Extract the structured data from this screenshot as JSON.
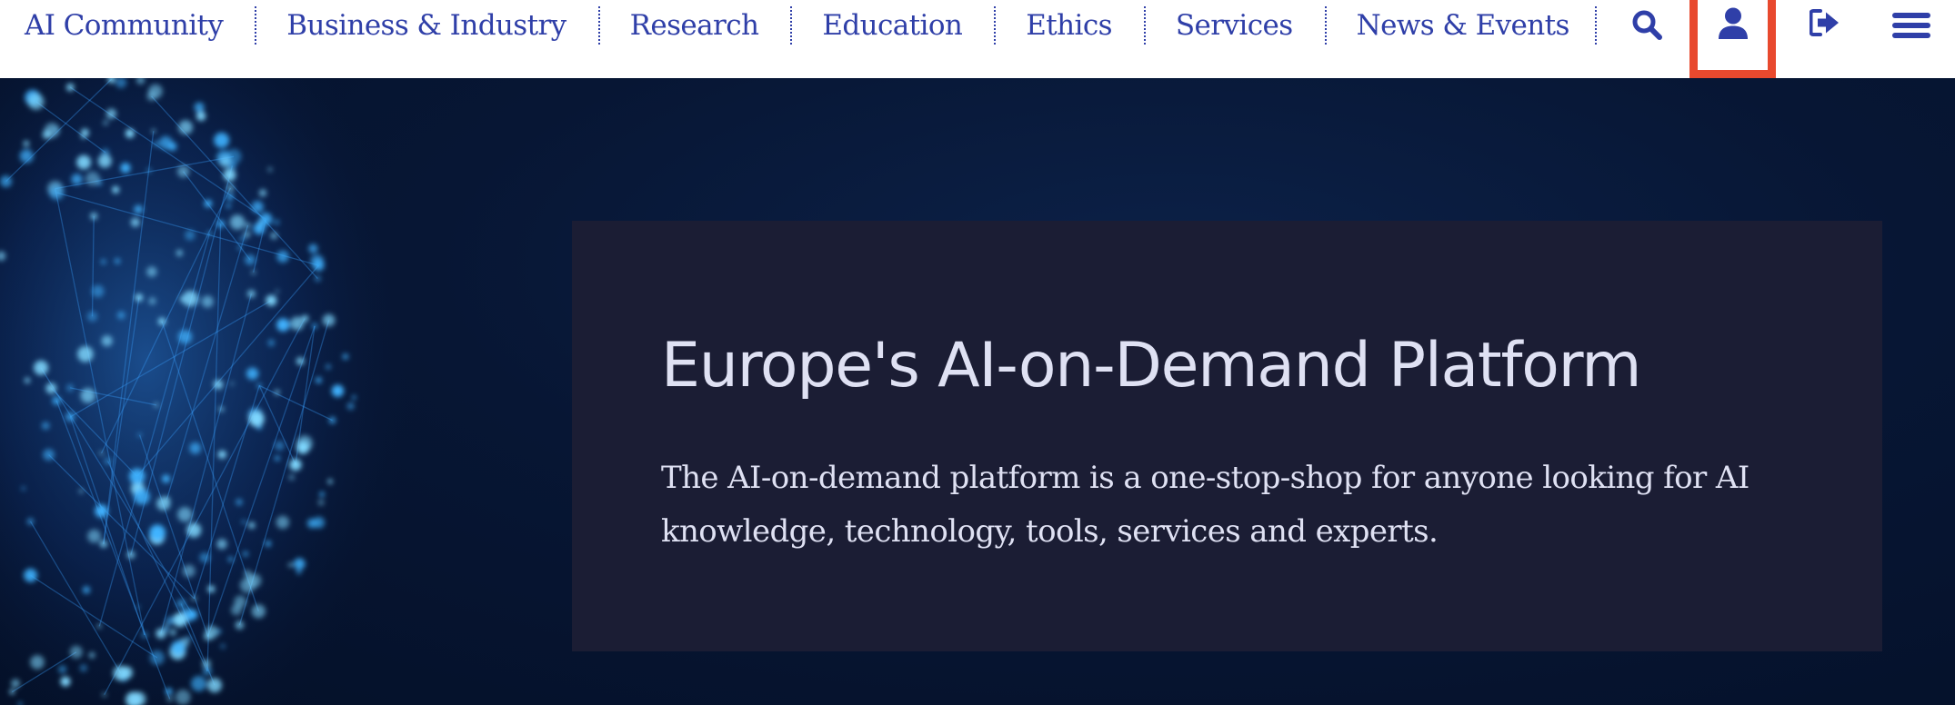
{
  "nav": {
    "links": [
      {
        "label": "AI Community"
      },
      {
        "label": "Business & Industry"
      },
      {
        "label": "Research"
      },
      {
        "label": "Education"
      },
      {
        "label": "Ethics"
      },
      {
        "label": "Services"
      },
      {
        "label": "News & Events"
      }
    ],
    "icons": {
      "search": "search-icon",
      "user": "user-icon",
      "logout": "sign-out-icon",
      "menu": "hamburger-menu-icon"
    },
    "link_color": "#2f3fa8",
    "highlight_color": "#e8492e"
  },
  "hero": {
    "title": "Europe's AI-on-Demand Platform",
    "text": "The AI-on-demand platform is a one-stop-shop for anyone looking for AI knowledge, technology, tools, services and experts.",
    "background_color": "#071634",
    "panel_color": "#1b1d34"
  }
}
